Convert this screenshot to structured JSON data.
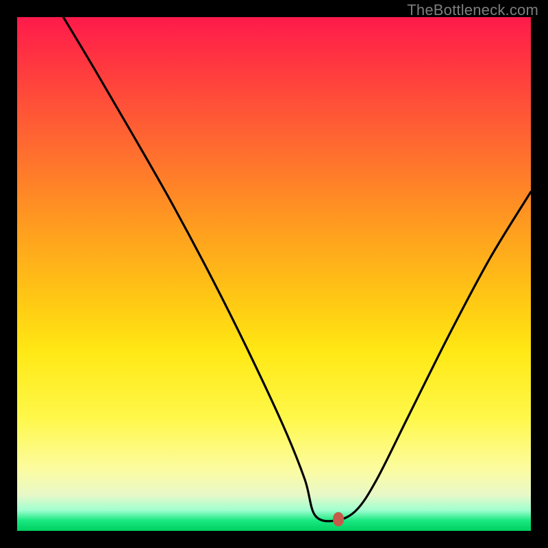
{
  "attribution": "TheBottleneck.com",
  "marker": {
    "x_pct": 62.5,
    "y_pct": 97.7
  },
  "chart_data": {
    "type": "line",
    "title": "",
    "xlabel": "",
    "ylabel": "",
    "xlim": [
      0,
      100
    ],
    "ylim": [
      0,
      100
    ],
    "grid": false,
    "legend": false,
    "series": [
      {
        "name": "bottleneck_curve",
        "x": [
          9,
          15,
          22,
          30,
          38,
          45,
          52,
          56,
          58,
          62,
          66,
          70,
          76,
          84,
          92,
          100
        ],
        "y": [
          100,
          90,
          78,
          64,
          49,
          35,
          20,
          10,
          3,
          2,
          4,
          10,
          22,
          38,
          53,
          66
        ]
      }
    ],
    "annotations": [
      {
        "type": "marker",
        "x": 62.5,
        "y": 2.3,
        "color": "#c65a4a"
      }
    ],
    "background_gradient": {
      "direction": "vertical",
      "stops": [
        {
          "pct": 0,
          "color": "#ff1a4b"
        },
        {
          "pct": 50,
          "color": "#ffc814"
        },
        {
          "pct": 80,
          "color": "#fff84a"
        },
        {
          "pct": 96,
          "color": "#9fffd0"
        },
        {
          "pct": 100,
          "color": "#00d060"
        }
      ]
    }
  }
}
